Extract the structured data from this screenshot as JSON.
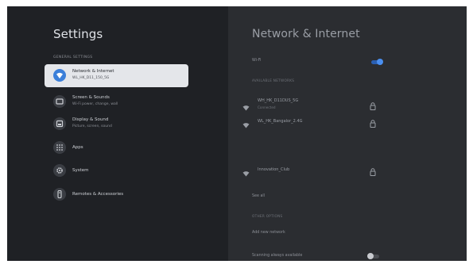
{
  "left": {
    "title": "Settings",
    "section": "GENERAL SETTINGS",
    "items": [
      {
        "title": "Network & Internet",
        "subtitle": "WL_HK_D11_150_5G",
        "icon": "wifi-icon"
      },
      {
        "title": "Screen & Sounds",
        "subtitle": "Wi-Fi power, change, wall",
        "icon": "screen-icon"
      },
      {
        "title": "Display & Sound",
        "subtitle": "Picture, screen, sound",
        "icon": "display-icon"
      },
      {
        "title": "Apps",
        "subtitle": "",
        "icon": "apps-grid-icon"
      },
      {
        "title": "System",
        "subtitle": "",
        "icon": "gear-icon"
      },
      {
        "title": "Remotes & Accessories",
        "subtitle": "",
        "icon": "remote-icon"
      }
    ]
  },
  "right": {
    "title": "Network & Internet",
    "wifi_label": "Wi-Fi",
    "available_label": "AVAILABLE NETWORKS",
    "networks": [
      {
        "ssid": "WH_HK_D11DUS_5G",
        "status": "Connected",
        "icon": "wifi-icon",
        "locked": true
      },
      {
        "ssid": "WL_HK_Bangalor_2.4G",
        "status": "",
        "icon": "wifi-icon",
        "locked": true
      },
      {
        "ssid": "Innovation_Club",
        "status": "",
        "icon": "wifi-icon",
        "locked": true
      }
    ],
    "see_all": "See all",
    "other_label": "OTHER OPTIONS",
    "add_network": "Add new network",
    "scanning": "Scanning always available"
  },
  "colors": {
    "accent": "#3b7fd9",
    "background": "#1f2125",
    "right_background": "#2b2d31",
    "selected_item": "#e4e6ea"
  }
}
